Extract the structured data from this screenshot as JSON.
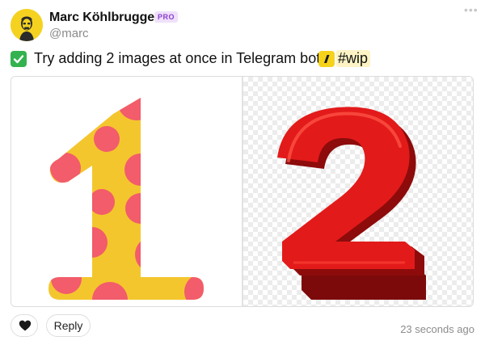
{
  "post": {
    "author_name": "Marc Köhlbrugge",
    "badge": "PRO",
    "handle": "@marc",
    "more_menu": "•••",
    "status_icon": "check-box-icon",
    "todo_text": "Try adding 2 images at once in Telegram bot",
    "project_icon": "wip-logo-icon",
    "hashtag": "#wip",
    "timestamp": "23 seconds ago"
  },
  "images": [
    {
      "name": "digit-one-polka-dot",
      "depicts": "1"
    },
    {
      "name": "digit-two-red-3d",
      "depicts": "2"
    }
  ],
  "actions": {
    "like_icon": "heart-icon",
    "reply_label": "Reply"
  },
  "colors": {
    "check_green": "#34b250",
    "badge_purple": "#8a3ed1",
    "wip_yellow": "#f6d21b",
    "digit_one_yellow": "#f4c62e",
    "digit_one_dots": "#f25c6b",
    "digit_two_red": "#e31a1a"
  }
}
